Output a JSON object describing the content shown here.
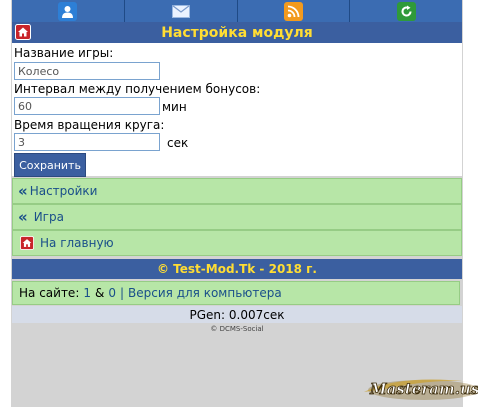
{
  "colors": {
    "header_blue": "#3b5fa0",
    "title_yellow": "#ffdd33",
    "menu_green": "#b7e6a7",
    "link_blue": "#1a4f8a"
  },
  "nav": {
    "icons": [
      "user-icon",
      "mail-icon",
      "rss-icon",
      "refresh-icon"
    ]
  },
  "header": {
    "title": "Настройка модуля"
  },
  "form": {
    "game_name_label": "Название игры:",
    "game_name_value": "Колесо",
    "interval_label": "Интервал между получением бонусов:",
    "interval_value": "60",
    "interval_unit": "мин",
    "rotation_label": "Время вращения круга:",
    "rotation_value": "3",
    "rotation_unit": "сек",
    "save_label": "Сохранить"
  },
  "menu": {
    "settings": "Настройки",
    "game": "Игра",
    "home": "На главную"
  },
  "footer": {
    "copyright": "© Test-Mod.Tk - 2018 г.",
    "online_prefix": "На сайте:",
    "online_count_a": "1",
    "online_amp": "&",
    "online_count_b": "0",
    "separator": "|",
    "desktop_link": "Версия для компьютера",
    "pgen": "PGen: 0.007сек",
    "engine": "© DCMS-Social"
  },
  "watermark": {
    "text": "Masteram.us"
  }
}
